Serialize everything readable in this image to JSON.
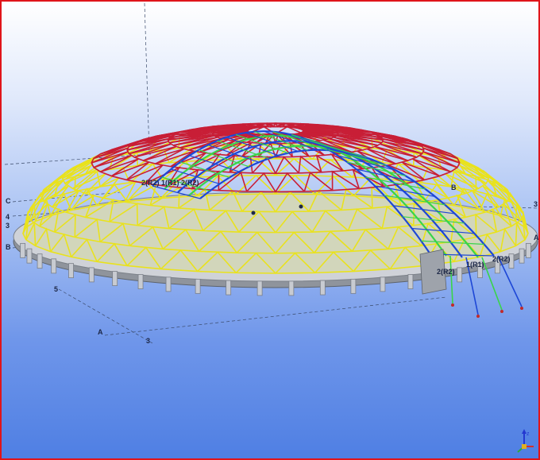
{
  "viewport": {
    "grid_labels": {
      "c_left": "C",
      "four_left": "4",
      "three_left": "3",
      "b_left": "B",
      "five_left": "5",
      "a_bottom": "A",
      "three_bottom": "3",
      "three_right": "3",
      "a_right": "A",
      "b_top_right": "B"
    },
    "arch_labels": {
      "left_group": "2(R2)  1(R1)  2(R2)",
      "right_upper": "1(R1)",
      "right_upper_2": "2(R2)",
      "right_lower": "2(R2)"
    },
    "colors": {
      "background_top": "#ffffff",
      "background_bottom": "#4f7fe3",
      "frame": "#e0141a",
      "dome_upper": "#c81e36",
      "dome_lower": "#e9e21d",
      "arch_green": "#39d44a",
      "arch_blue": "#1d47d6",
      "ring_beam": "#9aa0aa",
      "columns": "#c8cbd1"
    },
    "icons": [
      "axis-gizmo-icon"
    ]
  }
}
